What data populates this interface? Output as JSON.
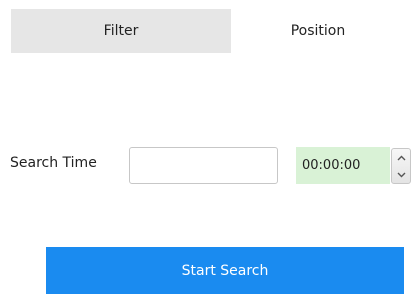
{
  "tabs": {
    "filter_label": "Filter",
    "position_label": "Position"
  },
  "search_time": {
    "label": "Search Time",
    "input_value": "",
    "time_value": "00:00:00"
  },
  "actions": {
    "start_search_label": "Start Search"
  },
  "colors": {
    "tab_inactive_bg": "#e6e6e6",
    "time_field_bg": "#d9f2d6",
    "primary_button": "#1a8bf0"
  },
  "icons": {
    "spin_up": "chevron-up-icon",
    "spin_down": "chevron-down-icon"
  }
}
